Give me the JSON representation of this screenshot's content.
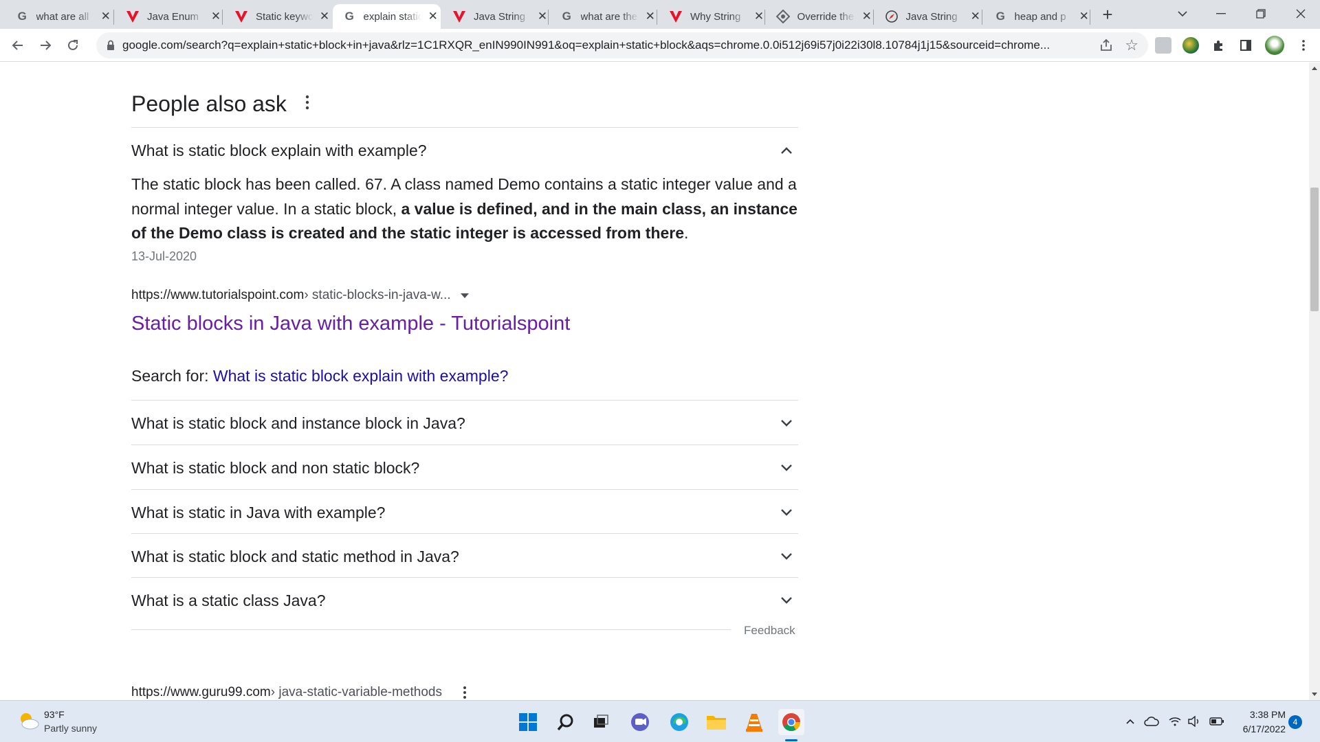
{
  "tabs": [
    {
      "title": "what are all",
      "icon": "google-icon"
    },
    {
      "title": "Java Enum",
      "icon": "vivaldi-icon"
    },
    {
      "title": "Static keyword",
      "icon": "vivaldi-icon"
    },
    {
      "title": "explain static",
      "icon": "google-icon",
      "active": true
    },
    {
      "title": "Java String",
      "icon": "vivaldi-icon"
    },
    {
      "title": "what are the",
      "icon": "google-icon"
    },
    {
      "title": "Why String",
      "icon": "vivaldi-icon"
    },
    {
      "title": "Override the",
      "icon": "diamond-icon"
    },
    {
      "title": "Java String",
      "icon": "compass-icon"
    },
    {
      "title": "heap and p",
      "icon": "google-icon"
    }
  ],
  "address_bar": {
    "url": "google.com/search?q=explain+static+block+in+java&rlz=1C1RXQR_enIN990IN991&oq=explain+static+block&aqs=chrome.0.0i512j69i57j0i22i30l8.10784j1j15&sourceid=chrome..."
  },
  "paa": {
    "title": "People also ask",
    "expanded": {
      "question": "What is static block explain with example?",
      "answer_plain_1": "The static block has been called. 67. A class named Demo contains a static integer value and a normal integer value. In a static block, ",
      "answer_bold": "a value is defined, and in the main class, an instance of the Demo class is created and the static integer is accessed from there",
      "answer_plain_2": ".",
      "date": "13-Jul-2020",
      "cite_domain": "https://www.tutorialspoint.com",
      "cite_path": " › static-blocks-in-java-w...",
      "result_title": "Static blocks in Java with example - Tutorialspoint",
      "search_for_label": "Search for: ",
      "search_for_link": "What is static block explain with example?"
    },
    "questions": [
      "What is static block and instance block in Java?",
      "What is static block and non static block?",
      "What is static in Java with example?",
      "What is static block and static method in Java?",
      "What is a static class Java?"
    ],
    "feedback": "Feedback"
  },
  "next_result": {
    "cite_domain": "https://www.guru99.com",
    "cite_path": " › java-static-variable-methods"
  },
  "taskbar": {
    "weather_temp": "93°F",
    "weather_desc": "Partly sunny",
    "time": "3:38 PM",
    "date": "6/17/2022",
    "notifications": "4"
  },
  "colors": {
    "visited_link": "#681da8",
    "link": "#1a0dab",
    "tabstrip": "#dee1e6",
    "taskbar": "#dfe8f3"
  }
}
